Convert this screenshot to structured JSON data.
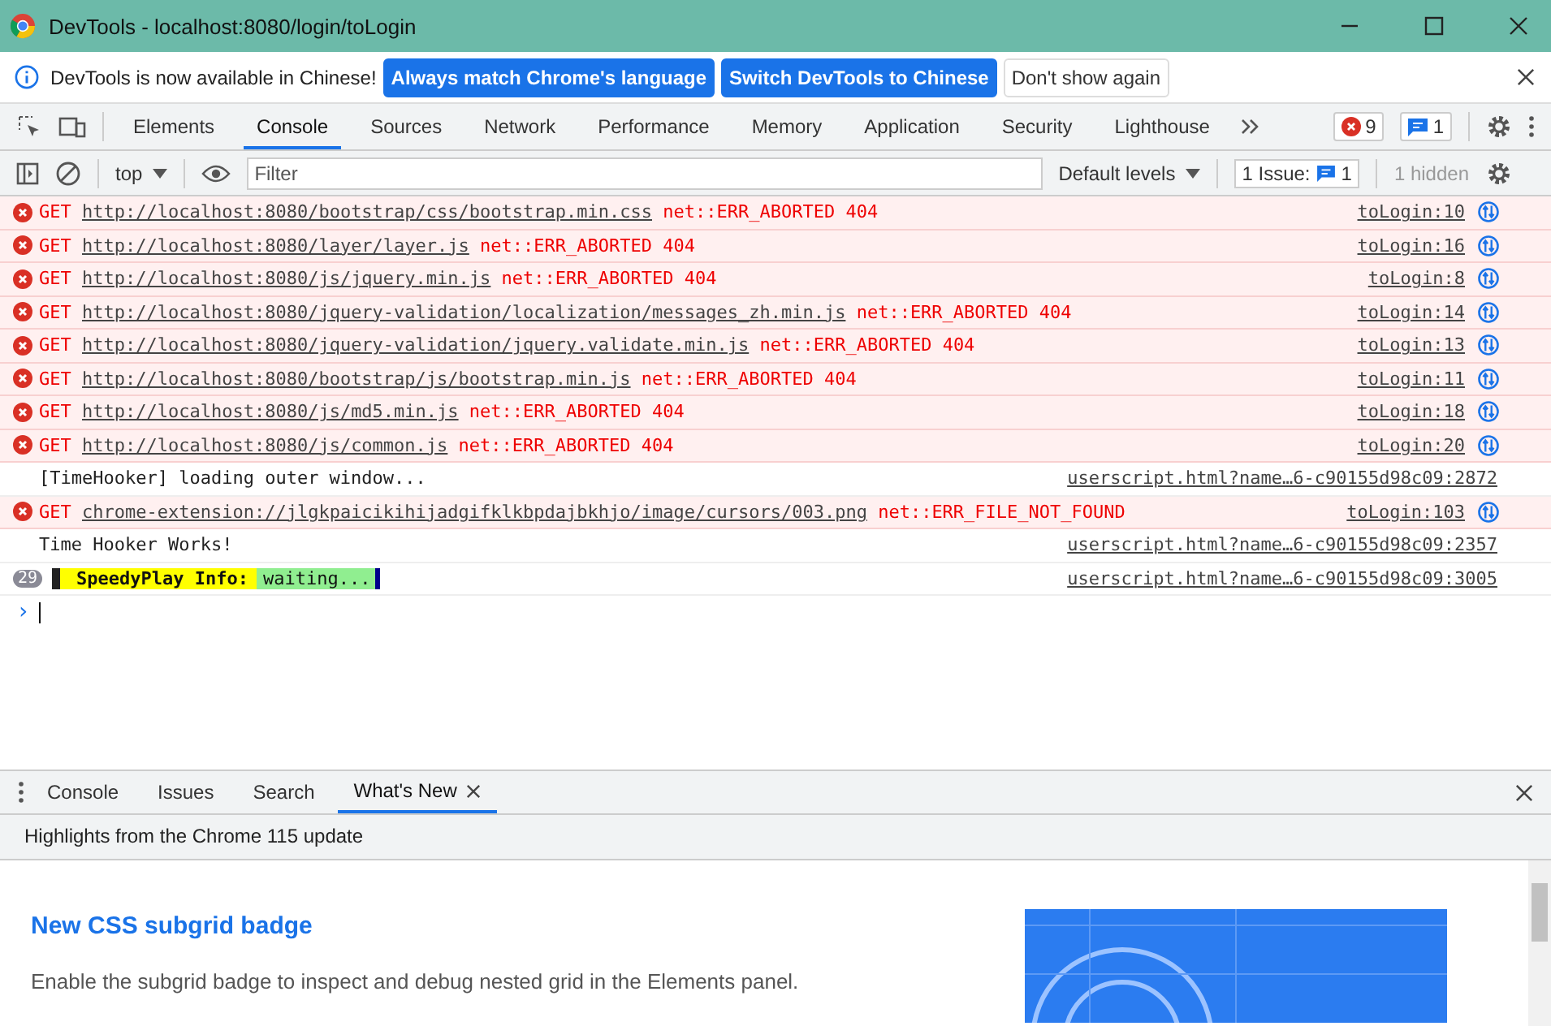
{
  "window": {
    "title": "DevTools - localhost:8080/login/toLogin"
  },
  "infobar": {
    "message": "DevTools is now available in Chinese!",
    "buttons": [
      {
        "label": "Always match Chrome's language",
        "kind": "primary"
      },
      {
        "label": "Switch DevTools to Chinese",
        "kind": "primary"
      },
      {
        "label": "Don't show again",
        "kind": "plain"
      }
    ]
  },
  "tabs": [
    {
      "label": "Elements",
      "selected": false
    },
    {
      "label": "Console",
      "selected": true
    },
    {
      "label": "Sources",
      "selected": false
    },
    {
      "label": "Network",
      "selected": false
    },
    {
      "label": "Performance",
      "selected": false
    },
    {
      "label": "Memory",
      "selected": false
    },
    {
      "label": "Application",
      "selected": false
    },
    {
      "label": "Security",
      "selected": false
    },
    {
      "label": "Lighthouse",
      "selected": false
    }
  ],
  "counters": {
    "errors": "9",
    "messages": "1"
  },
  "toolbar": {
    "context": "top",
    "filter_placeholder": "Filter",
    "levels": "Default levels",
    "issues_label": "1 Issue:",
    "issues_count": "1",
    "hidden": "1 hidden"
  },
  "log": [
    {
      "kind": "error",
      "method": "GET",
      "url": "http://localhost:8080/bootstrap/css/bootstrap.min.css",
      "message": "net::ERR_ABORTED 404",
      "source": "toLogin:10"
    },
    {
      "kind": "error",
      "method": "GET",
      "url": "http://localhost:8080/layer/layer.js",
      "message": "net::ERR_ABORTED 404",
      "source": "toLogin:16"
    },
    {
      "kind": "error",
      "method": "GET",
      "url": "http://localhost:8080/js/jquery.min.js",
      "message": "net::ERR_ABORTED 404",
      "source": "toLogin:8"
    },
    {
      "kind": "error",
      "method": "GET",
      "url": "http://localhost:8080/jquery-validation/localization/messages_zh.min.js",
      "message": "net::ERR_ABORTED 404",
      "source": "toLogin:14"
    },
    {
      "kind": "error",
      "method": "GET",
      "url": "http://localhost:8080/jquery-validation/jquery.validate.min.js",
      "message": "net::ERR_ABORTED 404",
      "source": "toLogin:13"
    },
    {
      "kind": "error",
      "method": "GET",
      "url": "http://localhost:8080/bootstrap/js/bootstrap.min.js",
      "message": "net::ERR_ABORTED 404",
      "source": "toLogin:11"
    },
    {
      "kind": "error",
      "method": "GET",
      "url": "http://localhost:8080/js/md5.min.js",
      "message": "net::ERR_ABORTED 404",
      "source": "toLogin:18"
    },
    {
      "kind": "error",
      "method": "GET",
      "url": "http://localhost:8080/js/common.js",
      "message": "net::ERR_ABORTED 404",
      "source": "toLogin:20"
    },
    {
      "kind": "info",
      "text": "[TimeHooker] loading outer window...",
      "source": "userscript.html?name…6-c90155d98c09:2872"
    },
    {
      "kind": "error",
      "method": "GET",
      "url": "chrome-extension://jlgkpaicikihijadgifklkbpdajbkhjo/image/cursors/003.png",
      "message": "net::ERR_FILE_NOT_FOUND",
      "source": "toLogin:103"
    },
    {
      "kind": "info",
      "text": "Time Hooker Works!",
      "source": "userscript.html?name…6-c90155d98c09:2357"
    },
    {
      "kind": "styled",
      "count": "29",
      "segments": [
        {
          "text": "SpeedyPlay Info:",
          "color": "#ffff00"
        },
        {
          "text": "waiting...",
          "color": "#90ee90"
        }
      ],
      "source": "userscript.html?name…6-c90155d98c09:3005"
    }
  ],
  "prompt": "›",
  "drawer": {
    "tabs": [
      {
        "label": "Console",
        "selected": false
      },
      {
        "label": "Issues",
        "selected": false
      },
      {
        "label": "Search",
        "selected": false
      },
      {
        "label": "What's New",
        "selected": true
      }
    ],
    "highlights": "Highlights from the Chrome 115 update",
    "article_title": "New CSS subgrid badge",
    "article_text": "Enable the subgrid badge to inspect and debug nested grid in the Elements panel."
  }
}
